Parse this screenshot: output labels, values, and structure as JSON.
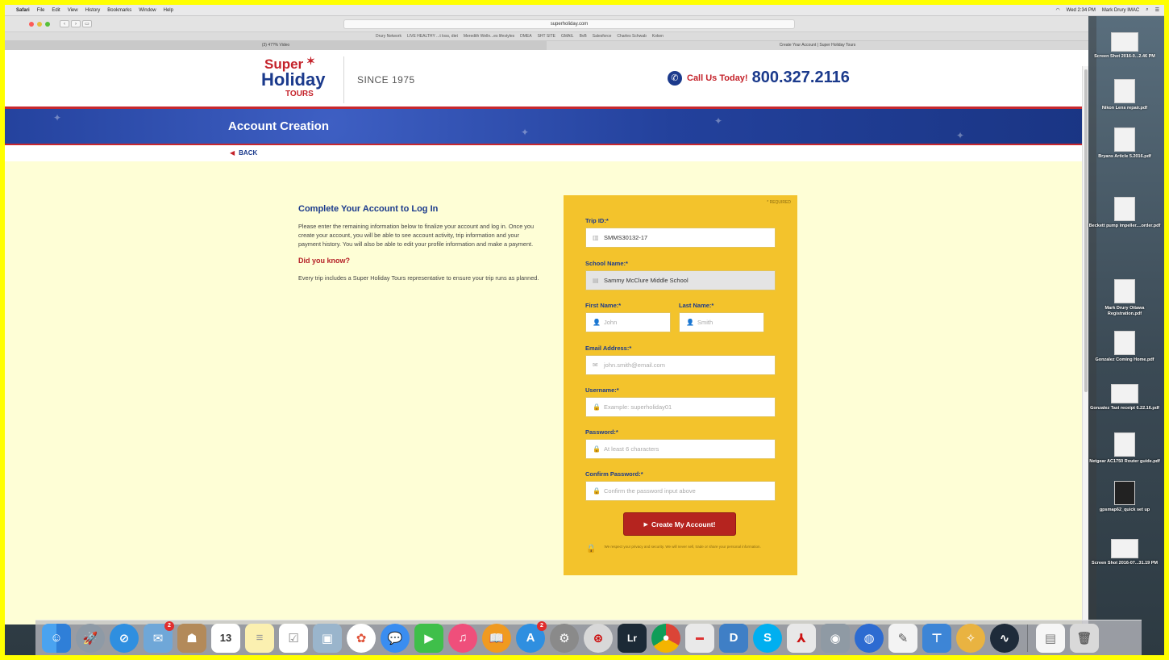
{
  "menubar": {
    "app": "Safari",
    "items": [
      "File",
      "Edit",
      "View",
      "History",
      "Bookmarks",
      "Window",
      "Help"
    ],
    "clock": "Wed 2:34 PM",
    "user": "Mark Drury IMAC"
  },
  "browser": {
    "url": "superholiday.com",
    "bookmarks": [
      "Drury Network",
      "LIVE HEALTHY ...t loss, diet",
      "Meredith Welln...es lifestyles",
      "DMEA",
      "SHT SITE",
      "GMAIL",
      "BvB",
      "Salesforce",
      "Charles Schwab",
      "Koken"
    ],
    "tabs": [
      "(3) 47?% Video",
      "Create Your Account | Super Holiday Tours"
    ]
  },
  "header": {
    "logo_line1": "Super",
    "logo_line2": "Holiday",
    "logo_line3": "TOURS",
    "since": "SINCE 1975",
    "call_text": "Call Us Today!",
    "phone": "800.327.2116"
  },
  "banner": {
    "title": "Account Creation"
  },
  "nav": {
    "back": "BACK"
  },
  "intro": {
    "heading": "Complete Your Account to Log In",
    "body": "Please enter the remaining information below to finalize your account and log in. Once you create your account, you will be able to see account activity, trip information and your payment history. You will also be able to edit your profile information and make a payment.",
    "did_you_know": "Did you know?",
    "fact": "Every trip includes a Super Holiday Tours representative to ensure your trip runs as planned."
  },
  "form": {
    "required_note": "* REQUIRED",
    "trip_id": {
      "label": "Trip ID:*",
      "value": "SMMS30132-17"
    },
    "school": {
      "label": "School Name:*",
      "value": "Sammy McClure Middle School"
    },
    "first_name": {
      "label": "First Name:*",
      "placeholder": "John"
    },
    "last_name": {
      "label": "Last Name:*",
      "placeholder": "Smith"
    },
    "email": {
      "label": "Email Address:*",
      "placeholder": "john.smith@email.com"
    },
    "username": {
      "label": "Username:*",
      "placeholder": "Example: superholiday01"
    },
    "password": {
      "label": "Password:*",
      "placeholder": "At least 6 characters"
    },
    "confirm": {
      "label": "Confirm Password:*",
      "placeholder": "Confirm the password input above"
    },
    "submit": "Create My Account!",
    "privacy": "We respect your privacy and security. We will never sell, trade or share your personal information."
  },
  "desktop": [
    {
      "label": "Screen Shot 2016-0...2.46 PM"
    },
    {
      "label": "Nikon Lens repair.pdf"
    },
    {
      "label": "Bryans Article 5.2016.pdf"
    },
    {
      "label": "Beckett pump impeller....order.pdf"
    },
    {
      "label": "Mark Drury Ottawa Registration.pdf"
    },
    {
      "label": "Gonzalez Coming Home.pdf"
    },
    {
      "label": "Gonzalez Taxi receipt 6.22.16.pdf"
    },
    {
      "label": "Netgear AC1750 Router guide.pdf"
    },
    {
      "label": "gpsmap62_quick set up"
    },
    {
      "label": "Screen Shot 2016-07...31.19 PM"
    }
  ],
  "dock": {
    "mail_badge": "2",
    "appstore_badge": "2",
    "calendar_day": "13",
    "lightroom": "Lr",
    "skype": "S"
  },
  "colors": {
    "brand_blue": "#1b3a8c",
    "brand_red": "#c4222a",
    "form_yellow": "#f3c32c",
    "page_cream": "#fefed6"
  }
}
